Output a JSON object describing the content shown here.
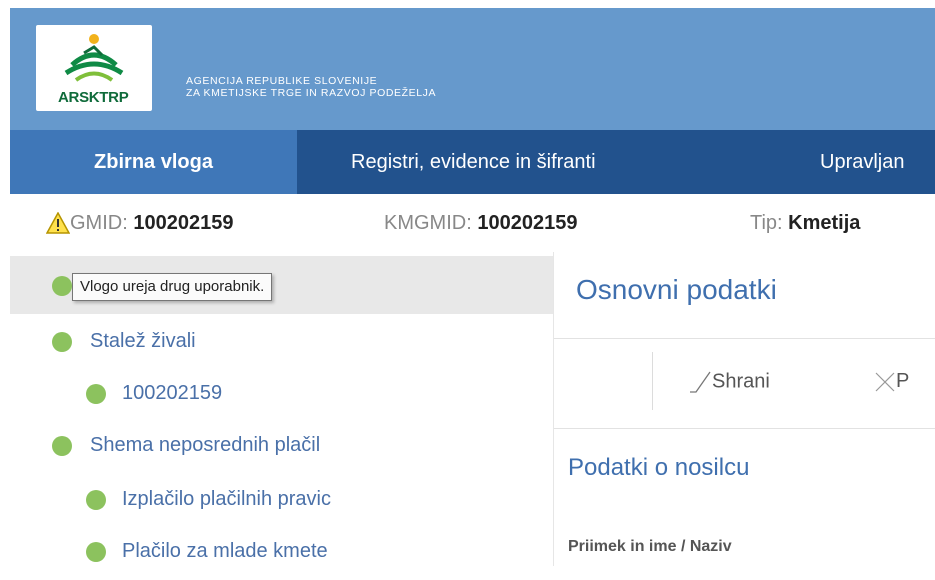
{
  "header": {
    "logo_text": "ARSKTRP",
    "agency_line1": "AGENCIJA REPUBLIKE SLOVENIJE",
    "agency_line2": "ZA KMETIJSKE TRGE IN RAZVOJ PODEŽELJA"
  },
  "nav": {
    "items": [
      {
        "label": "Zbirna vloga"
      },
      {
        "label": "Registri, evidence in šifranti"
      },
      {
        "label": "Upravljan"
      }
    ]
  },
  "info": {
    "gmid_label": "GMID:",
    "gmid_value": "100202159",
    "kmgmid_label": "KMGMID:",
    "kmgmid_value": "100202159",
    "tip_label": "Tip:",
    "tip_value": "Kmetija"
  },
  "sidebar": {
    "tooltip": "Vlogo ureja drug uporabnik.",
    "items": [
      {
        "label": ""
      },
      {
        "label": "Stalež živali"
      },
      {
        "label": "100202159"
      },
      {
        "label": "Shema neposrednih plačil"
      },
      {
        "label": "Izplačilo plačilnih pravic"
      },
      {
        "label": "Plačilo za mlade kmete"
      }
    ]
  },
  "main": {
    "title": "Osnovni podatki",
    "save_label": "Shrani",
    "cancel_label": "P",
    "section_title": "Podatki o nosilcu",
    "field_label": "Priimek in ime / Naziv"
  },
  "colors": {
    "header_bg": "#6699cc",
    "nav_bg": "#22528d",
    "nav_active": "#3f77b8",
    "status_dot": "#8cc25e",
    "link": "#4a70a8"
  }
}
